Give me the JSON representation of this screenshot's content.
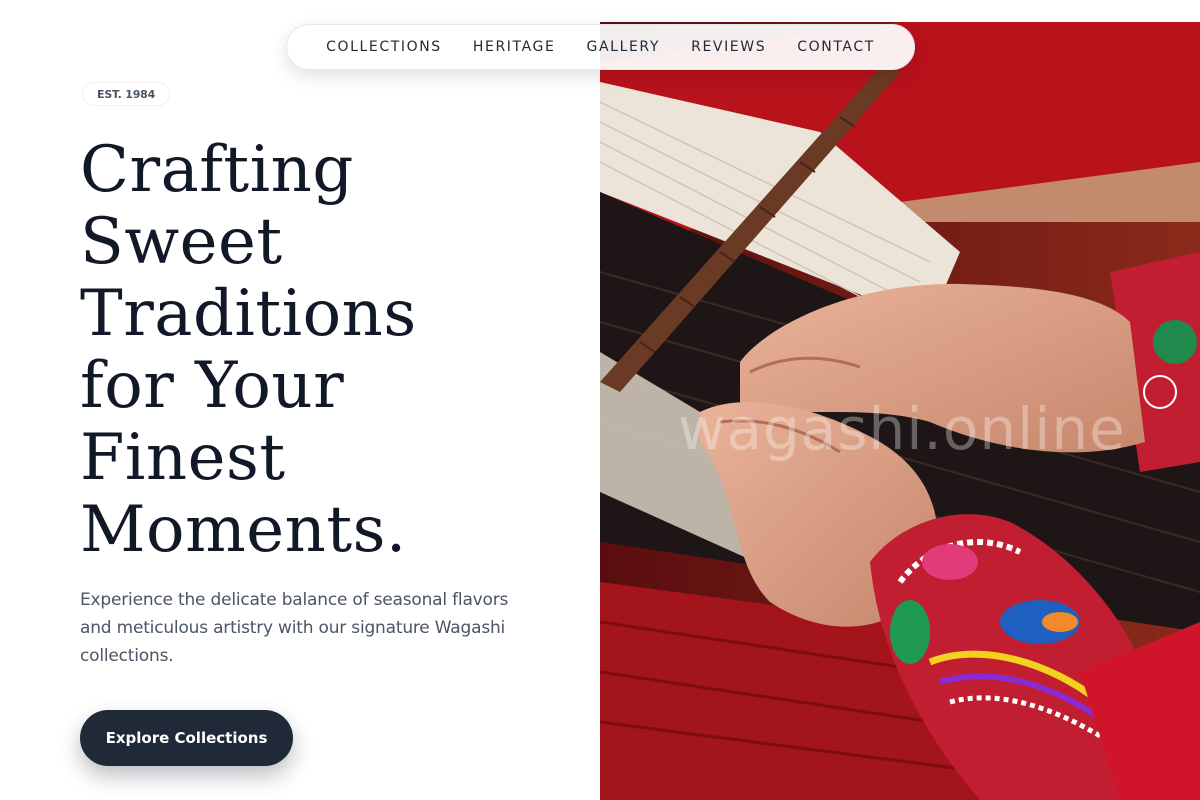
{
  "nav": {
    "items": [
      "COLLECTIONS",
      "HERITAGE",
      "GALLERY",
      "REVIEWS",
      "CONTACT"
    ]
  },
  "hero": {
    "badge": "EST. 1984",
    "headline_lines": [
      "Crafting",
      "Sweet",
      "Traditions",
      "for Your",
      "Finest",
      "Moments."
    ],
    "description": "Experience the delicate balance of seasonal flavors and meticulous artistry with our signature Wagashi collections.",
    "cta_label": "Explore Collections",
    "watermark": "wagashi.online",
    "image_subject": "hands-weaving-loom-photo"
  },
  "colors": {
    "ink": "#111827",
    "button_bg": "#1f2937",
    "body_text": "#4b5563",
    "loom_red": "#b8121b"
  }
}
